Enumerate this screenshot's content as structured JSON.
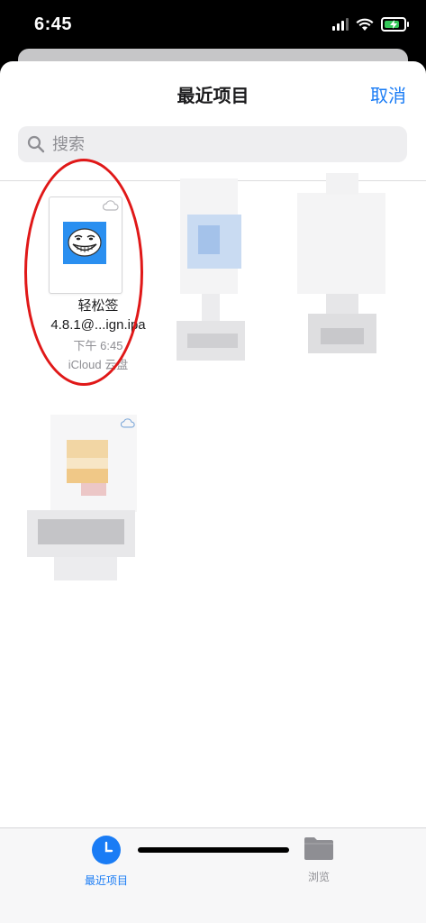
{
  "status_bar": {
    "time": "6:45"
  },
  "nav": {
    "title": "最近项目",
    "cancel_label": "取消"
  },
  "search": {
    "placeholder": "搜索"
  },
  "files": [
    {
      "name_line1": "轻松签",
      "name_line2": "4.8.1@...ign.ipa",
      "time": "下午 6:45",
      "location": "iCloud 云盘"
    }
  ],
  "tabs": [
    {
      "label": "最近项目",
      "icon": "clock-icon",
      "active": true
    },
    {
      "label": "浏览",
      "icon": "folder-icon",
      "active": false
    }
  ],
  "colors": {
    "accent": "#1a7cf5",
    "annotation": "#e01818",
    "charging": "#34c759"
  }
}
